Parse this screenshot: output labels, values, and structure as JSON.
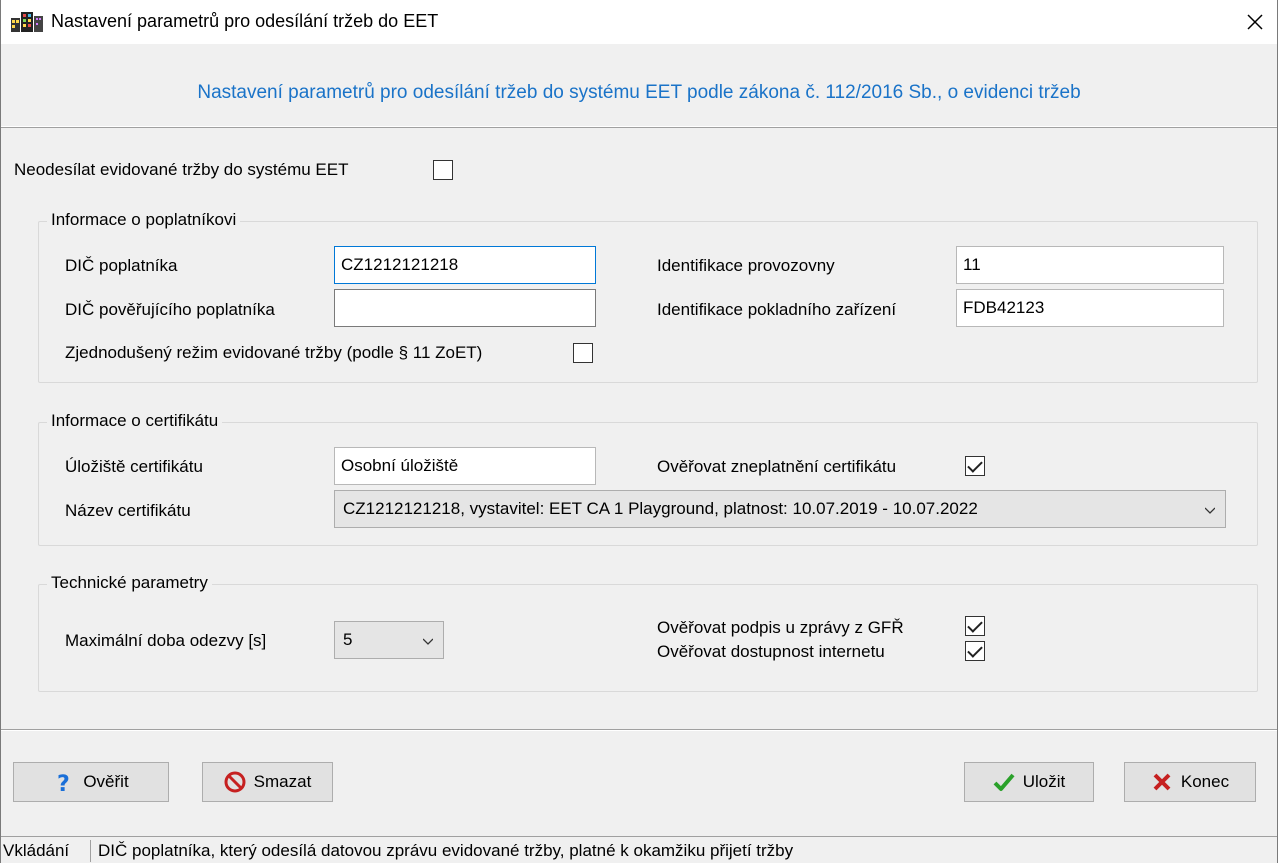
{
  "window": {
    "title": "Nastavení parametrů pro odesílání tržeb do EET",
    "close_glyph": "✕"
  },
  "header": {
    "text": "Nastavení parametrů pro odesílání tržeb do systému EET podle zákona č. 112/2016 Sb., o evidenci tržeb",
    "color": "#1a73c8"
  },
  "top_option": {
    "label": "Neodesílat evidované tržby do systému EET",
    "checked": false
  },
  "taxpayer_group": {
    "title": "Informace o poplatníkovi",
    "dic_label": "DIČ poplatníka",
    "dic_value": "CZ1212121218",
    "dic_authorizing_label": "DIČ pověřujícího poplatníka",
    "dic_authorizing_value": "",
    "establishment_label": "Identifikace provozovny",
    "establishment_value": "11",
    "cash_register_label": "Identifikace pokladního zařízení",
    "cash_register_value": "FDB42123",
    "simplified_label": "Zjednodušený režim evidované tržby (podle § 11 ZoET)",
    "simplified_checked": false
  },
  "certificate_group": {
    "title": "Informace o certifikátu",
    "store_label": "Úložiště certifikátu",
    "store_value": "Osobní úložiště",
    "verify_revocation_label": "Ověřovat zneplatnění certifikátu",
    "verify_revocation_checked": true,
    "name_label": "Název certifikátu",
    "name_value": "CZ1212121218, vystavitel: EET CA 1 Playground, platnost: 10.07.2019 - 10.07.2022"
  },
  "technical_group": {
    "title": "Technické parametry",
    "timeout_label": "Maximální doba odezvy [s]",
    "timeout_value": "5",
    "verify_signature_label": "Ověřovat podpis u zprávy z GFŘ",
    "verify_signature_checked": true,
    "verify_internet_label": "Ověřovat dostupnost internetu",
    "verify_internet_checked": true
  },
  "buttons": {
    "verify": "Ověřit",
    "delete": "Smazat",
    "save": "Uložit",
    "close": "Konec"
  },
  "statusbar": {
    "mode": "Vkládání",
    "hint": "DIČ poplatníka, který odesílá datovou zprávu evidované tržby, platné k okamžiku přijetí tržby"
  }
}
